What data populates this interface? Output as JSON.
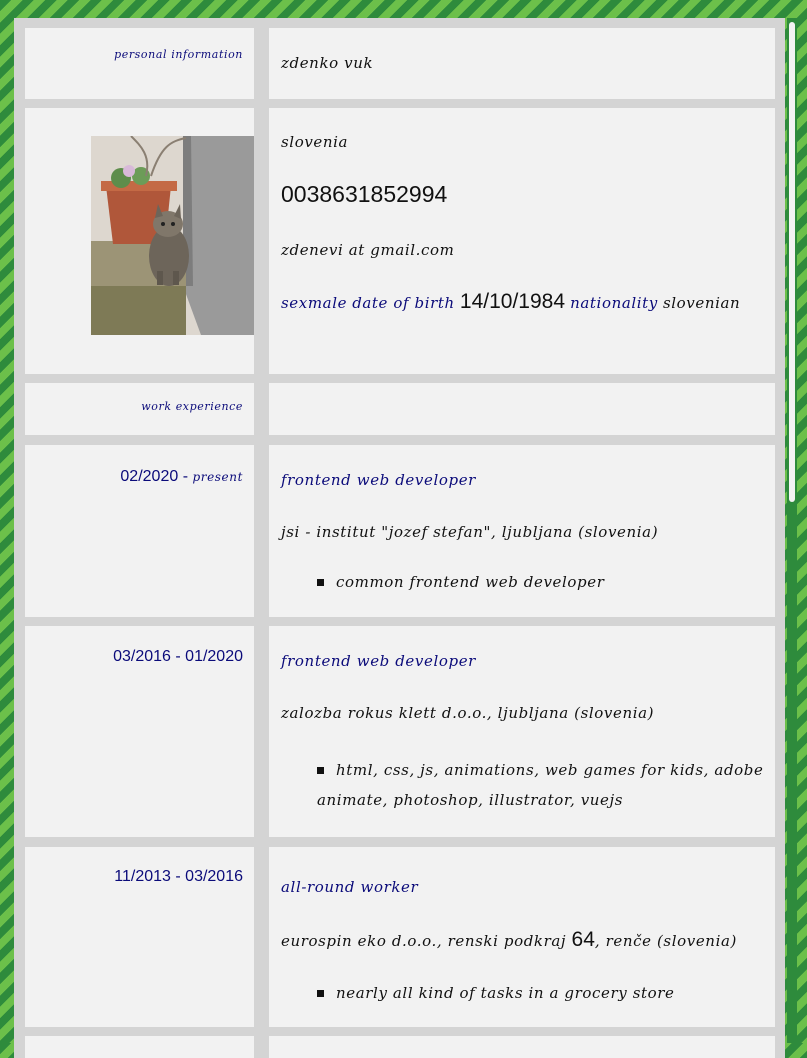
{
  "personal": {
    "section_label": "personal information",
    "name": "zdenko vuk",
    "country": "slovenia",
    "phone": "0038631852994",
    "email": "zdenevi at gmail.com",
    "sex_label": "sex",
    "sex_value": "male",
    "dob_label": "date of birth",
    "dob_value": "14/10/1984",
    "nationality_label": "nationality",
    "nationality_value": "slovenian"
  },
  "work": {
    "section_label": "work experience",
    "jobs": [
      {
        "date_start": "02/2020 - ",
        "date_end": "present",
        "title": "frontend web developer",
        "employer": "jsi - institut \"jozef stefan\", ljubljana (slovenia)",
        "bullets": [
          "common frontend web developer"
        ]
      },
      {
        "date": "03/2016 - 01/2020",
        "title": "frontend web developer",
        "employer": "zalozba rokus klett d.o.o., ljubljana (slovenia)",
        "bullet_line1": "html, css, js, animations, web games for kids, adobe",
        "bullet_line2": "animate, photoshop, illustrator, vuejs"
      },
      {
        "date": "11/2013 - 03/2016",
        "title": "all-round worker",
        "employer_pre": "eurospin eko d.o.o., renski podkraj ",
        "employer_num": "64",
        "employer_post": ", renče (slovenia)",
        "bullets": [
          "nearly all kind of tasks in a grocery store"
        ]
      }
    ]
  },
  "colors": {
    "accent": "#0b0b7a",
    "stripe_dark": "#2e8b3c",
    "stripe_light": "#6cc04a",
    "cell_bg": "#f2f2f2",
    "gutter": "#d4d4d4"
  }
}
